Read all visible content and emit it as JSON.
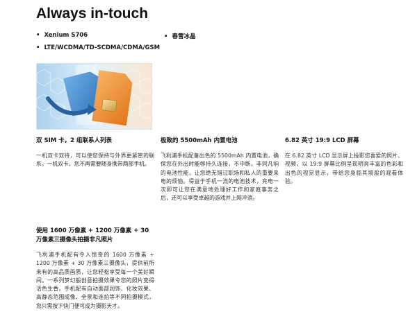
{
  "page": {
    "title": "Always in-touch"
  },
  "bullets": [
    "Xenium S706",
    "春雪冰晶",
    "LTE/WCDMA/TD-SCDMA/CDMA/GSM"
  ],
  "features": [
    {
      "title": "双 SIM 卡，2 组联系人列表",
      "text": "一机双卡双待，可以使您保持与外界更紧密的联系。一机双卡，您不再需要随身携带两部手机。"
    },
    {
      "title": "极致的 5500mAh 内置电池",
      "text": "飞利浦手机配备出色的 5500mAh 内置电池，确保您在外出时能够持久连接，不中断。非同凡响的电池性能，让您绝无错过职场和私人的重要来电的烦恼。得益于手机一流的电池技术，充电一次即可让您在满意地处理好工作和家庭事务之后，还可以享受卓越的游戏并上网冲浪。"
    },
    {
      "title": "6.82 英寸 19:9 LCD 屏幕",
      "text": "在 6.82 英寸 LCD 显示屏上投影您喜爱的照片、视频，以 19:9 屏幕比例呈现明亮丰富的色彩和出色的视觉显示，带给您身临其境般的观看体验。"
    },
    {
      "title": "使用 1600 万像素 + 1200 万像素 + 30 万像素三摄像头拍摄非凡照片",
      "text": "飞利浦手机配有令人惊奇的 1600 万像素 + 1200 万像素 + 30 万像素三摄像头，提供前所未有的高品质画质，让您轻松享受每一个美好瞬间。一系列梦幻般创意拍摄效果令您的照片变得活色生香。手机配有自动面部润饰、化妆效果、高静态范围成像、全景和连拍等不同拍摄模式，您只需按下快门便可成为摄影天才。"
    }
  ],
  "image": {
    "icon": "dual-sim-cards-illustration",
    "colors": {
      "blue_card": "#3f7fc1",
      "orange_card": "#ee8a2b",
      "chip": "#e7c26c",
      "arrow": "#2a5fa0"
    }
  }
}
